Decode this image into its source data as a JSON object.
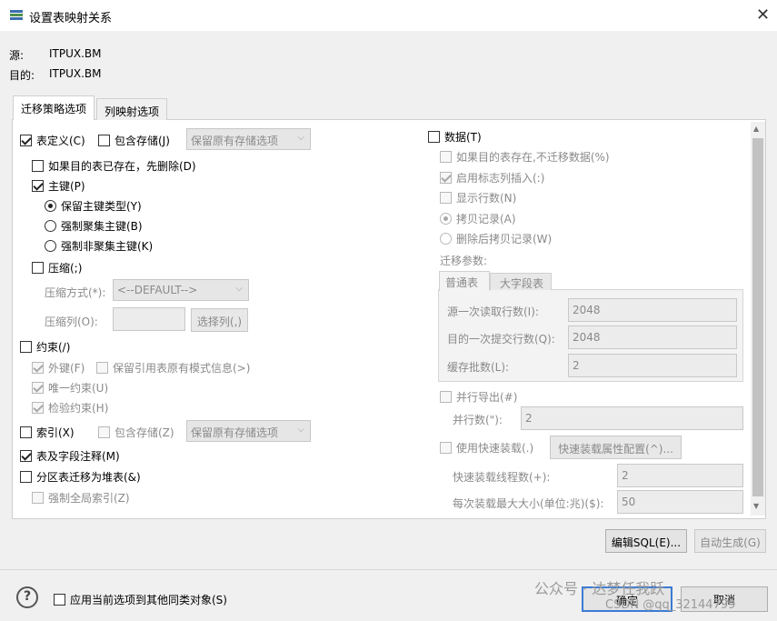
{
  "window": {
    "title": "设置表映射关系",
    "close_glyph": "✕"
  },
  "header": {
    "source_label": "源:",
    "source_value": "ITPUX.BM",
    "target_label": "目的:",
    "target_value": "ITPUX.BM"
  },
  "tabs": [
    {
      "label": "迁移策略选项"
    },
    {
      "label": "列映射选项"
    }
  ],
  "left": {
    "table_def": "表定义(C)",
    "include_storage": "包含存储(J)",
    "storage_combo": "保留原有存储选项",
    "drop_if_exists": "如果目的表已存在，先删除(D)",
    "primary_key": "主键(P)",
    "keep_pk_type": "保留主键类型(Y)",
    "force_clustered": "强制聚集主键(B)",
    "force_nonclustered": "强制非聚集主键(K)",
    "compress": "压缩(;)",
    "compress_method_label": "压缩方式(*):",
    "compress_method_value": "<--DEFAULT-->",
    "compress_cols_label": "压缩列(O):",
    "select_cols_btn": "选择列(,)",
    "constraint": "约束(/)",
    "foreign_key": "外键(F)",
    "keep_ref_schema": "保留引用表原有模式信息(>)",
    "unique": "唯一约束(U)",
    "check": "检验约束(H)",
    "index": "索引(X)",
    "index_include_storage": "包含存储(Z)",
    "index_storage_combo": "保留原有存储选项",
    "table_comment": "表及字段注释(M)",
    "partition_heap": "分区表迁移为堆表(&)",
    "force_global_index": "强制全局索引(Z)"
  },
  "right": {
    "data": "数据(T)",
    "skip_if_exists": "如果目的表存在,不迁移数据(%)",
    "enable_identity": "启用标志列插入(:)",
    "show_rows": "显示行数(N)",
    "copy_records": "拷贝记录(A)",
    "delete_then_copy": "删除后拷贝记录(W)",
    "params_label": "迁移参数:",
    "param_tabs": [
      "普通表",
      "大字段表"
    ],
    "read_rows_label": "源一次读取行数(I):",
    "read_rows_value": "2048",
    "commit_rows_label": "目的一次提交行数(Q):",
    "commit_rows_value": "2048",
    "batch_label": "缓存批数(L):",
    "batch_value": "2",
    "parallel_export": "并行导出(#)",
    "parallel_count_label": "并行数(\"):",
    "parallel_count_value": "2",
    "fast_load": "使用快速装载(.)",
    "fast_load_btn": "快速装载属性配置(^)...",
    "fast_threads_label": "快速装载线程数(+):",
    "fast_threads_value": "2",
    "max_size_label": "每次装载最大大小(单位:兆)($):",
    "max_size_value": "50"
  },
  "buttons": {
    "edit_sql": "编辑SQL(E)...",
    "auto_gen": "自动生成(G)",
    "ok": "确定",
    "cancel": "取消"
  },
  "footer": {
    "help_glyph": "?",
    "apply_all": "应用当前选项到其他同类对象(S)",
    "watermark_1": "公众号 · 达梦任我跃",
    "watermark_2": "CSDN @qq_32144799"
  },
  "colors": {
    "accent": "#3a7bd5",
    "panel": "#ffffff",
    "dialog": "#f0f0f0",
    "disabled_text": "#8a8a8a"
  }
}
